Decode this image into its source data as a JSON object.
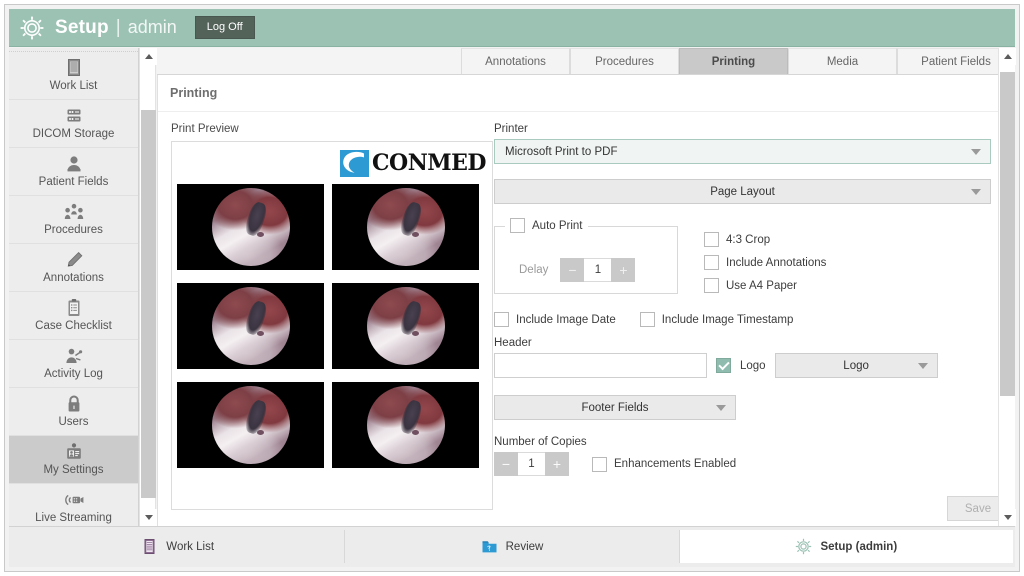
{
  "window": {
    "title": "Setup",
    "separator": "|",
    "user": "admin",
    "logoff_label": "Log Off",
    "logo_icon": "gear-icon",
    "accent_color": "#9cc2b4",
    "logoff_color": "#53635a"
  },
  "sidebar": {
    "items": [
      {
        "label": "Work List",
        "icon": "clipboard-icon",
        "selected": false
      },
      {
        "label": "DICOM Storage",
        "icon": "server-icon",
        "selected": false
      },
      {
        "label": "Patient Fields",
        "icon": "person-icon",
        "selected": false
      },
      {
        "label": "Procedures",
        "icon": "people-icon",
        "selected": false
      },
      {
        "label": "Annotations",
        "icon": "pencil-icon",
        "selected": false
      },
      {
        "label": "Case Checklist",
        "icon": "checklist-icon",
        "selected": false
      },
      {
        "label": "Activity Log",
        "icon": "activity-icon",
        "selected": false
      },
      {
        "label": "Users",
        "icon": "lock-icon",
        "selected": false
      },
      {
        "label": "My Settings",
        "icon": "id-badge-icon",
        "selected": true
      },
      {
        "label": "Live Streaming",
        "icon": "video-cast-icon",
        "selected": false
      }
    ]
  },
  "tabs": [
    {
      "label": "Annotations",
      "active": false
    },
    {
      "label": "Procedures",
      "active": false
    },
    {
      "label": "Printing",
      "active": true
    },
    {
      "label": "Media",
      "active": false
    },
    {
      "label": "Patient Fields",
      "active": false
    }
  ],
  "page": {
    "title": "Printing"
  },
  "preview": {
    "label": "Print Preview",
    "brand_text_first": "C",
    "brand_text_rest": "ON",
    "brand_text_m": "M",
    "brand_text_end": "ED",
    "brand_full": "CONMED",
    "brand_mark_color": "#2e9ad4",
    "thumb_caption": "0",
    "rows": 3,
    "cols": 2
  },
  "settings": {
    "printer_label": "Printer",
    "printer_value": "Microsoft Print to PDF",
    "page_layout_label": "Page Layout",
    "auto_print_label": "Auto Print",
    "auto_print_checked": false,
    "delay_label": "Delay",
    "delay_value": "1",
    "delay_minus": "−",
    "delay_plus": "+",
    "crop_label": "4:3 Crop",
    "crop_checked": false,
    "include_annotations_label": "Include Annotations",
    "include_annotations_checked": false,
    "use_a4_label": "Use A4 Paper",
    "use_a4_checked": false,
    "include_image_date_label": "Include Image Date",
    "include_image_date_checked": false,
    "include_image_timestamp_label": "Include Image Timestamp",
    "include_image_timestamp_checked": false,
    "header_label": "Header",
    "header_value": "",
    "header_placeholder": "",
    "logo_checkbox_label": "Logo",
    "logo_checkbox_checked": true,
    "logo_select_value": "Logo",
    "footer_fields_label": "Footer Fields",
    "number_of_copies_label": "Number of Copies",
    "copies_value": "1",
    "copies_minus": "−",
    "copies_plus": "+",
    "enhancements_label": "Enhancements Enabled",
    "enhancements_checked": false,
    "save_label": "Save",
    "save_enabled": false,
    "checkbox_accent": "#8fbcae"
  },
  "bottombar": {
    "items": [
      {
        "label": "Work List",
        "icon": "worklist-icon",
        "active": false
      },
      {
        "label": "Review",
        "icon": "folder-icon",
        "active": false
      },
      {
        "label": "Setup (admin)",
        "icon": "gear-icon",
        "active": true
      }
    ]
  }
}
